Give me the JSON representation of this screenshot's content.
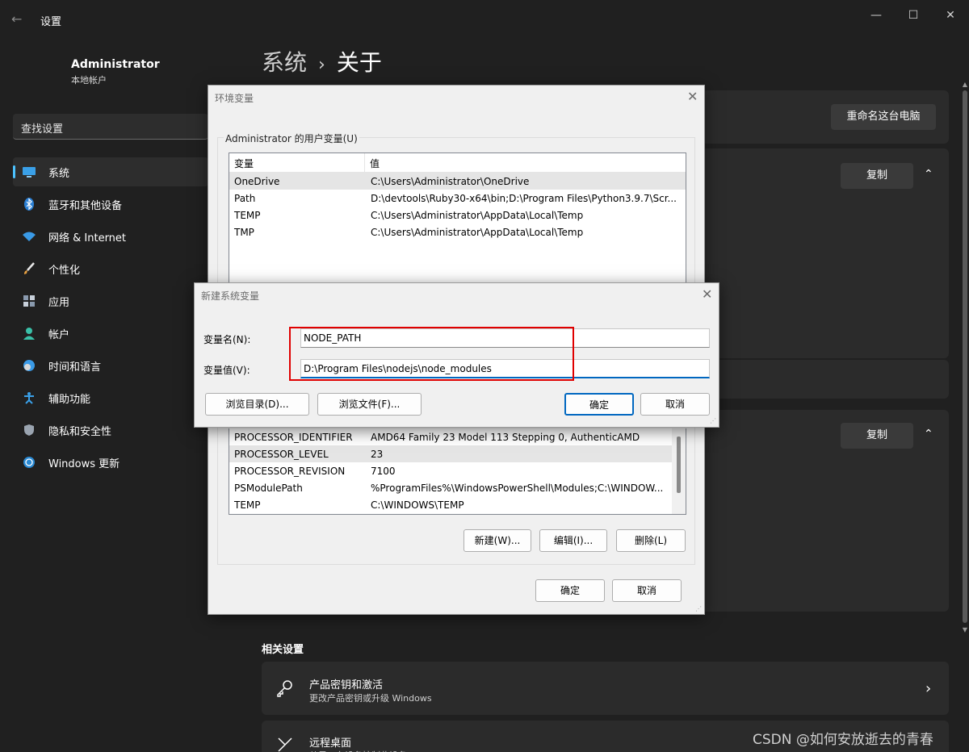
{
  "window": {
    "app_title": "设置",
    "back_glyph": "←",
    "minimize_glyph": "—",
    "maximize_glyph": "☐",
    "close_glyph": "✕"
  },
  "user": {
    "name": "Administrator",
    "account_type": "本地帐户"
  },
  "search": {
    "placeholder": "查找设置"
  },
  "nav": {
    "items": [
      {
        "label": "系统",
        "icon": "monitor-icon",
        "active": true
      },
      {
        "label": "蓝牙和其他设备",
        "icon": "bluetooth-icon"
      },
      {
        "label": "网络 & Internet",
        "icon": "wifi-icon"
      },
      {
        "label": "个性化",
        "icon": "brush-icon"
      },
      {
        "label": "应用",
        "icon": "apps-icon"
      },
      {
        "label": "帐户",
        "icon": "person-icon"
      },
      {
        "label": "时间和语言",
        "icon": "globe-clock-icon"
      },
      {
        "label": "辅助功能",
        "icon": "accessibility-icon"
      },
      {
        "label": "隐私和安全性",
        "icon": "shield-icon"
      },
      {
        "label": "Windows 更新",
        "icon": "sync-icon"
      }
    ]
  },
  "breadcrumb": {
    "parent": "系统",
    "separator": "›",
    "current": "关于"
  },
  "main": {
    "rename_button": "重命名这台电脑",
    "copy_button_1": "复制",
    "copy_button_2": "复制",
    "related_heading": "相关设置",
    "related": [
      {
        "title": "产品密钥和激活",
        "subtitle": "更改产品密钥或升级 Windows",
        "icon": "key-icon"
      },
      {
        "title": "远程桌面",
        "subtitle": "从另一台设备控制此设备",
        "icon": "remote-icon"
      }
    ],
    "chevron_glyph": "›",
    "chevron_up_glyph": "⌃"
  },
  "env_dialog": {
    "title": "环境变量",
    "close_glyph": "✕",
    "user_group_label": "Administrator 的用户变量(U)",
    "columns": [
      "变量",
      "值"
    ],
    "user_vars": [
      {
        "name": "OneDrive",
        "value": "C:\\Users\\Administrator\\OneDrive"
      },
      {
        "name": "Path",
        "value": "D:\\devtools\\Ruby30-x64\\bin;D:\\Program Files\\Python3.9.7\\Scr..."
      },
      {
        "name": "TEMP",
        "value": "C:\\Users\\Administrator\\AppData\\Local\\Temp"
      },
      {
        "name": "TMP",
        "value": "C:\\Users\\Administrator\\AppData\\Local\\Temp"
      }
    ],
    "system_vars": [
      {
        "name": "PROCESSOR_IDENTIFIER",
        "value": "AMD64 Family 23 Model 113 Stepping 0, AuthenticAMD"
      },
      {
        "name": "PROCESSOR_LEVEL",
        "value": "23"
      },
      {
        "name": "PROCESSOR_REVISION",
        "value": "7100"
      },
      {
        "name": "PSModulePath",
        "value": "%ProgramFiles%\\WindowsPowerShell\\Modules;C:\\WINDOW..."
      },
      {
        "name": "TEMP",
        "value": "C:\\WINDOWS\\TEMP"
      }
    ],
    "new_button": "新建(W)...",
    "edit_button": "编辑(I)...",
    "delete_button": "删除(L)",
    "ok_button": "确定",
    "cancel_button": "取消"
  },
  "new_var_dialog": {
    "title": "新建系统变量",
    "close_glyph": "✕",
    "name_label": "变量名(N):",
    "value_label": "变量值(V):",
    "name_value": "NODE_PATH",
    "value_value": "D:\\Program Files\\nodejs\\node_modules",
    "browse_dir_button": "浏览目录(D)...",
    "browse_file_button": "浏览文件(F)...",
    "ok_button": "确定",
    "cancel_button": "取消"
  },
  "watermark": "CSDN @如何安放逝去的青春"
}
